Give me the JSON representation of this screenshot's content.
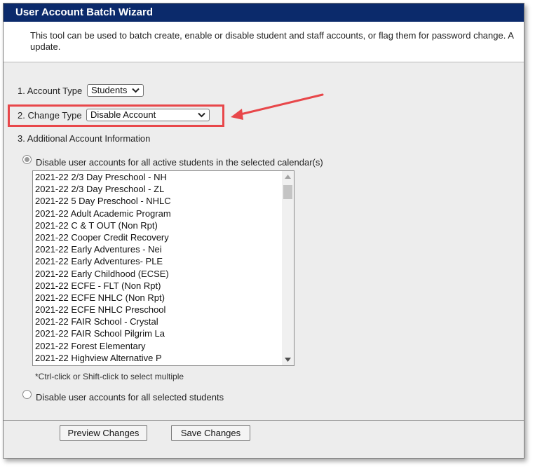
{
  "window": {
    "title": "User Account Batch Wizard"
  },
  "description": {
    "line1": "This tool can be used to batch create, enable or disable student and staff accounts, or flag them for password change. A",
    "line2": "update."
  },
  "form": {
    "account_type": {
      "label": "1. Account Type",
      "value": "Students"
    },
    "change_type": {
      "label": "2. Change Type",
      "value": "Disable Account"
    },
    "additional_info": {
      "label": "3. Additional Account Information"
    },
    "option_calendars": {
      "label": "Disable user accounts for all active students in the selected calendar(s)",
      "selected": true
    },
    "calendars": [
      "2021-22 2/3 Day Preschool - NH",
      "2021-22 2/3 Day Preschool - ZL",
      "2021-22 5 Day Preschool - NHLC",
      "2021-22 Adult Academic Program",
      "2021-22 C & T OUT (Non Rpt)",
      "2021-22 Cooper Credit Recovery",
      "2021-22 Early Adventures - Nei",
      "2021-22 Early Adventures- PLE",
      "2021-22 Early Childhood (ECSE)",
      "2021-22 ECFE - FLT (Non Rpt)",
      "2021-22 ECFE NHLC (Non Rpt)",
      "2021-22 ECFE NHLC Preschool",
      "2021-22 FAIR School - Crystal",
      "2021-22 FAIR School Pilgrim La",
      "2021-22 Forest Elementary",
      "2021-22 Highview Alternative P"
    ],
    "select_hint": "*Ctrl-click or Shift-click to select multiple",
    "option_students": {
      "label": "Disable user accounts for all selected students",
      "selected": false
    }
  },
  "buttons": {
    "preview": "Preview Changes",
    "save": "Save Changes"
  },
  "colors": {
    "titlebar": "#0b2a6b",
    "highlight": "#e8474a",
    "panel": "#ededed"
  }
}
